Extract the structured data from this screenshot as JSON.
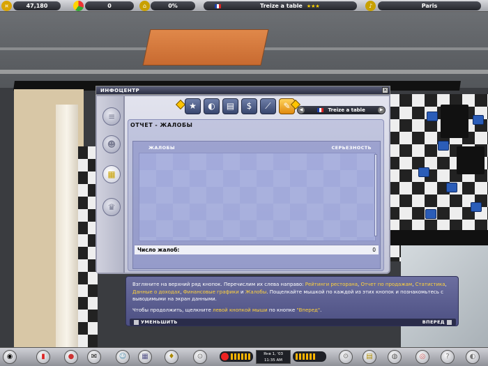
{
  "hud": {
    "money": "47,180",
    "customers": "0",
    "percent": "0%",
    "restaurant_name": "Treize a table",
    "city": "Paris",
    "icons": [
      "coins-icon",
      "pie-chart-icon",
      "building-icon",
      "star-rating-icon",
      "bell-icon"
    ]
  },
  "window": {
    "title": "ИНФОЦЕНТР",
    "close_label": "×",
    "restaurant_selector": "Treize a table",
    "selector_prev": "◀",
    "selector_next": "▶",
    "tabs": [
      {
        "name": "tab-ratings",
        "icon": "★"
      },
      {
        "name": "tab-sales-report",
        "icon": "◐"
      },
      {
        "name": "tab-income",
        "icon": "▤"
      },
      {
        "name": "tab-finance-charts",
        "icon": "$"
      },
      {
        "name": "tab-lines",
        "icon": "⟋"
      },
      {
        "name": "tab-complaints",
        "icon": "✎"
      }
    ],
    "side_buttons": [
      {
        "name": "side-btn-list",
        "icon": "≡"
      },
      {
        "name": "side-btn-people",
        "icon": "☻"
      },
      {
        "name": "side-btn-report",
        "icon": "▦"
      },
      {
        "name": "side-btn-trophy",
        "icon": "♛"
      }
    ]
  },
  "report": {
    "title": "ОТЧЕТ - ЖАЛОБЫ",
    "col_complaints": "ЖАЛОБЫ",
    "col_severity": "СЕРЬЕЗНОСТЬ",
    "count_label": "Число жалоб:",
    "count_value": "0"
  },
  "tutorial": {
    "p1_a": "Взгляните на верхний ряд кнопок. Перечислим их слева направо: ",
    "link_ratings": "Рейтинги ресторана",
    "sep1": ", ",
    "link_sales": "Отчет по продажам",
    "sep2": ", ",
    "link_stats": "Статистика",
    "sep3": ", ",
    "link_income": "Данные о доходах",
    "sep4": ", ",
    "link_fin": "Финансовые графики",
    "and": " и ",
    "link_complaints": "Жалобы",
    "p1_b": ". Пощелкайте мышкой по каждой из этих кнопок и познакомьтесь с выводимыми на экран данными.",
    "p2_a": "Чтобы продолжить, щелкните ",
    "link_mouse": "левой кнопкой мыши",
    "p2_b": " по кнопке ",
    "link_forward": "\"Вперед\"",
    "p2_c": ".",
    "minimize": "УМЕНЬШИТЬ",
    "forward": "ВПЕРЕД"
  },
  "clock": {
    "date": "Янв 1, '03",
    "time": "11:35 AM"
  }
}
